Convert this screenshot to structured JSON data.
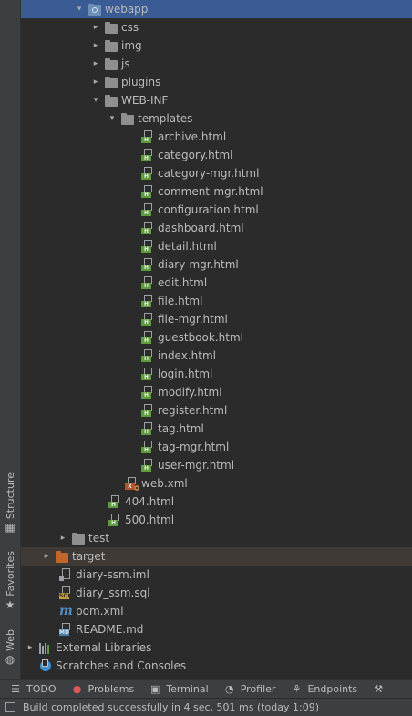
{
  "side_tabs": {
    "structure": "Structure",
    "favorites": "Favorites",
    "web": "Web"
  },
  "tree": {
    "webapp": "webapp",
    "css": "css",
    "img": "img",
    "js": "js",
    "plugins": "plugins",
    "web_inf": "WEB-INF",
    "templates": "templates",
    "template_files": [
      "archive.html",
      "category.html",
      "category-mgr.html",
      "comment-mgr.html",
      "configuration.html",
      "dashboard.html",
      "detail.html",
      "diary-mgr.html",
      "edit.html",
      "file.html",
      "file-mgr.html",
      "guestbook.html",
      "index.html",
      "login.html",
      "modify.html",
      "register.html",
      "tag.html",
      "tag-mgr.html",
      "user-mgr.html"
    ],
    "web_xml": "web.xml",
    "f404": "404.html",
    "f500": "500.html",
    "test": "test",
    "target": "target",
    "iml": "diary-ssm.iml",
    "sql": "diary_ssm.sql",
    "pom": "pom.xml",
    "readme": "README.md",
    "external_libraries": "External Libraries",
    "scratches": "Scratches and Consoles"
  },
  "tool_windows": {
    "todo": "TODO",
    "problems": "Problems",
    "terminal": "Terminal",
    "profiler": "Profiler",
    "endpoints": "Endpoints"
  },
  "status": {
    "message": "Build completed successfully in 4 sec, 501 ms (today 1:09)"
  },
  "colors": {
    "selection": "#3a5b94",
    "excluded": "#3f3a36",
    "html_badge": "#5e9b3f",
    "target_folder": "#c4662c",
    "problems_icon": "#e05555"
  }
}
